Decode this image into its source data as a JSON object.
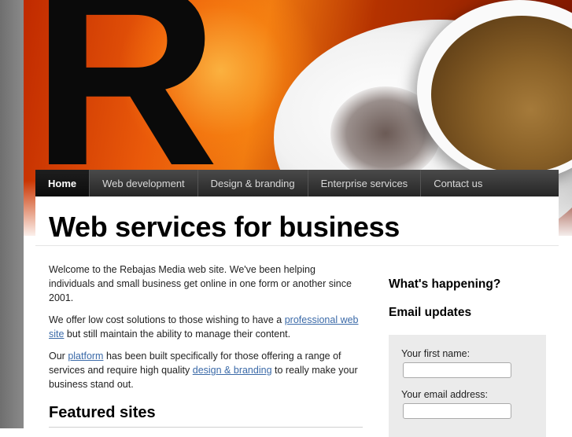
{
  "nav": {
    "items": [
      {
        "label": "Home",
        "active": true
      },
      {
        "label": "Web development",
        "active": false
      },
      {
        "label": "Design & branding",
        "active": false
      },
      {
        "label": "Enterprise services",
        "active": false
      },
      {
        "label": "Contact us",
        "active": false
      }
    ]
  },
  "hero": {
    "logo_letter": "R"
  },
  "main": {
    "title": "Web services for business",
    "intro": "Welcome to the Rebajas Media web site. We've been helping individuals and small business get online in one form or another since 2001.",
    "p2": {
      "before": "We offer low cost solutions to those wishing to have a ",
      "link": "professional web site",
      "after": " but still maintain the ability to manage their content."
    },
    "p3": {
      "before": "Our ",
      "link1": "platform",
      "middle": " has been built specifically for those offering a range of services and require high quality ",
      "link2": "design & branding",
      "after": " to really make your business stand out."
    },
    "featured_heading": "Featured sites"
  },
  "sidebar": {
    "whats_happening": "What's happening?",
    "email_updates": "Email updates",
    "first_name_label": "Your first name:",
    "first_name_value": "",
    "email_label": "Your email address:",
    "email_value": ""
  },
  "colors": {
    "nav_bg": "#333333",
    "link": "#3b6aa8",
    "signup_bg": "#ebebeb"
  }
}
